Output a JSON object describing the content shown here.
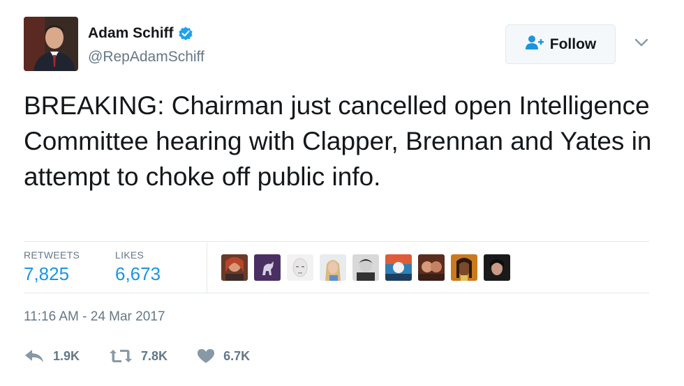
{
  "user": {
    "display_name": "Adam Schiff",
    "handle": "@RepAdamSchiff",
    "verified_icon": "verified-badge-icon",
    "avatar_icon": "profile-photo"
  },
  "follow_button": {
    "label": "Follow",
    "icon": "add-user-icon"
  },
  "menu": {
    "icon": "chevron-down-icon"
  },
  "tweet": {
    "text": "BREAKING: Chairman just cancelled open Intelligence Committee hearing with Clapper, Brennan and Yates in attempt to choke off public info."
  },
  "stats": {
    "retweets_label": "RETWEETS",
    "retweets_value": "7,825",
    "likes_label": "LIKES",
    "likes_value": "6,673"
  },
  "likers": [
    {
      "icon": "liker-avatar"
    },
    {
      "icon": "liker-avatar"
    },
    {
      "icon": "liker-avatar"
    },
    {
      "icon": "liker-avatar"
    },
    {
      "icon": "liker-avatar"
    },
    {
      "icon": "liker-avatar"
    },
    {
      "icon": "liker-avatar"
    },
    {
      "icon": "liker-avatar"
    },
    {
      "icon": "liker-avatar"
    }
  ],
  "timestamp": "11:16 AM - 24 Mar 2017",
  "actions": {
    "reply_count": "1.9K",
    "reply_icon": "reply-icon",
    "retweet_count": "7.8K",
    "retweet_icon": "retweet-icon",
    "like_count": "6.7K",
    "like_icon": "heart-icon"
  },
  "colors": {
    "accent": "#1b95e0",
    "secondary_text": "#657786",
    "primary_text": "#14171a",
    "border": "#e1e8ed"
  }
}
